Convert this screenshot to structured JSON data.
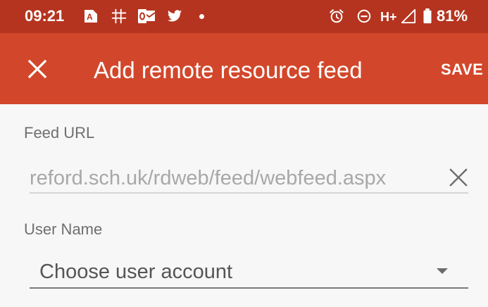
{
  "status_bar": {
    "time": "09:21",
    "network": "H+",
    "battery": "81%",
    "left_icons": [
      "authenticator-icon",
      "grid-app-icon",
      "outlook-icon",
      "twitter-icon",
      "notification-dot-icon"
    ],
    "right_icons": [
      "alarm-icon",
      "do-not-disturb-icon",
      "signal-icon",
      "battery-icon"
    ]
  },
  "app_bar": {
    "title": "Add remote resource feed",
    "save_label": "SAVE",
    "close_icon": "close-icon"
  },
  "form": {
    "feed_url": {
      "label": "Feed URL",
      "value": "reford.sch.uk/rdweb/feed/webfeed.aspx",
      "clear_icon": "clear-icon"
    },
    "user_name": {
      "label": "User Name",
      "selected": "Choose user account"
    }
  },
  "colors": {
    "status_bar": "#b5341f",
    "app_bar": "#d2472b",
    "background": "#f7f7f7"
  }
}
